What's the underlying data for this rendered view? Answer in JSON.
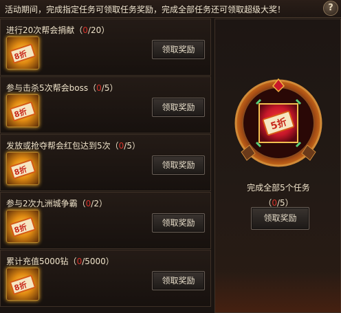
{
  "header": {
    "notice": "活动期间，完成指定任务可领取任务奖励，完成全部任务还可领取超级大奖！",
    "help_label": "?"
  },
  "tasks": [
    {
      "title": "进行20次帮会捐献",
      "current": "0",
      "sep": "/",
      "total": "20",
      "reward_label": "8折",
      "button": "领取奖励"
    },
    {
      "title": "参与击杀5次帮会boss",
      "current": "0",
      "sep": "/",
      "total": "5",
      "reward_label": "8折",
      "button": "领取奖励"
    },
    {
      "title": "发放或抢夺帮会红包达到5次",
      "current": "0",
      "sep": "/",
      "total": "5",
      "reward_label": "8折",
      "button": "领取奖励"
    },
    {
      "title": "参与2次九洲城争霸",
      "current": "0",
      "sep": "/",
      "total": "2",
      "reward_label": "8折",
      "button": "领取奖励"
    },
    {
      "title": "累计充值5000钻",
      "current": "0",
      "sep": "/",
      "total": "5000",
      "reward_label": "8折",
      "button": "领取奖励"
    }
  ],
  "grand_prize": {
    "reward_label": "5折",
    "title": "完成全部5个任务",
    "current": "0",
    "sep": "/",
    "total": "5",
    "button": "领取奖励"
  },
  "colors": {
    "progress_current": "#d6322a",
    "coupon_gold": "#ffcf4a",
    "medal_red": "#c8182a"
  }
}
